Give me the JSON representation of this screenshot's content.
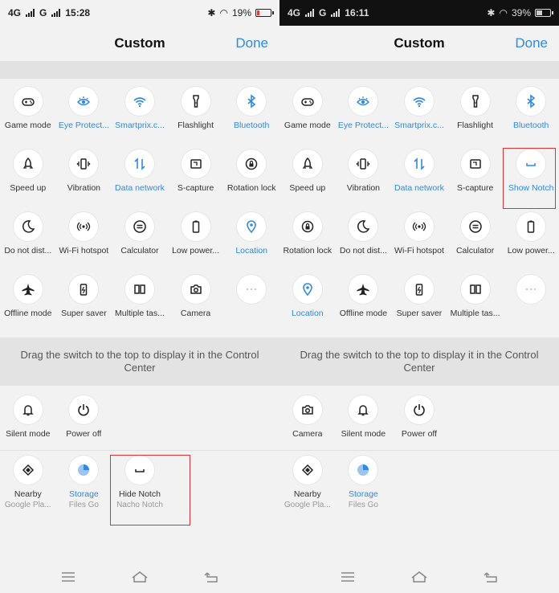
{
  "status_left": {
    "time": "15:28",
    "net1": "4G",
    "net2": "G",
    "battery": "19%",
    "battery_level": 0.19
  },
  "status_right": {
    "time": "16:11",
    "net1": "4G",
    "net2": "G",
    "battery": "39%",
    "battery_level": 0.39
  },
  "header": {
    "title": "Custom",
    "done": "Done"
  },
  "divider_text": "Drag the switch to the top to display it in the Control Center",
  "left_grid": [
    [
      {
        "label": "Game mode",
        "icon": "gamepad-icon",
        "active": false
      },
      {
        "label": "Eye Protect...",
        "icon": "eye-icon",
        "active": true
      },
      {
        "label": "Smartprix.c...",
        "icon": "wifi-icon",
        "active": true
      },
      {
        "label": "Flashlight",
        "icon": "flashlight-icon",
        "active": false
      },
      {
        "label": "Bluetooth",
        "icon": "bluetooth-icon",
        "active": true
      }
    ],
    [
      {
        "label": "Speed up",
        "icon": "rocket-icon",
        "active": false
      },
      {
        "label": "Vibration",
        "icon": "vibration-icon",
        "active": false
      },
      {
        "label": "Data network",
        "icon": "data-network-icon",
        "active": true
      },
      {
        "label": "S-capture",
        "icon": "screenshot-icon",
        "active": false
      },
      {
        "label": "Rotation lock",
        "icon": "rotation-lock-icon",
        "active": false
      }
    ],
    [
      {
        "label": "Do not dist...",
        "icon": "moon-icon",
        "active": false
      },
      {
        "label": "Wi-Fi hotspot",
        "icon": "hotspot-icon",
        "active": false
      },
      {
        "label": "Calculator",
        "icon": "calculator-icon",
        "active": false
      },
      {
        "label": "Low power...",
        "icon": "battery-icon",
        "active": false
      },
      {
        "label": "Location",
        "icon": "location-icon",
        "active": true
      }
    ],
    [
      {
        "label": "Offline mode",
        "icon": "airplane-icon",
        "active": false
      },
      {
        "label": "Super saver",
        "icon": "super-saver-icon",
        "active": false
      },
      {
        "label": "Multiple tas...",
        "icon": "multitask-icon",
        "active": false
      },
      {
        "label": "Camera",
        "icon": "camera-icon",
        "active": false
      },
      {
        "label": "",
        "icon": "more-icon",
        "active": false
      }
    ]
  ],
  "left_available": [
    [
      {
        "label": "Silent mode",
        "icon": "bell-icon",
        "sub": ""
      },
      {
        "label": "Power off",
        "icon": "power-icon",
        "sub": ""
      }
    ],
    [
      {
        "label": "Nearby",
        "icon": "nearby-icon",
        "sub": "Google Pla..."
      },
      {
        "label": "Storage",
        "icon": "storage-icon",
        "sub": "Files Go",
        "active": true
      },
      {
        "label": "Hide Notch",
        "icon": "notch-icon",
        "sub": "Nacho Notch"
      }
    ]
  ],
  "right_grid": [
    [
      {
        "label": "Game mode",
        "icon": "gamepad-icon",
        "active": false
      },
      {
        "label": "Eye Protect...",
        "icon": "eye-icon",
        "active": true
      },
      {
        "label": "Smartprix.c...",
        "icon": "wifi-icon",
        "active": true
      },
      {
        "label": "Flashlight",
        "icon": "flashlight-icon",
        "active": false
      },
      {
        "label": "Bluetooth",
        "icon": "bluetooth-icon",
        "active": true
      }
    ],
    [
      {
        "label": "Speed up",
        "icon": "rocket-icon",
        "active": false
      },
      {
        "label": "Vibration",
        "icon": "vibration-icon",
        "active": false
      },
      {
        "label": "Data network",
        "icon": "data-network-icon",
        "active": true
      },
      {
        "label": "S-capture",
        "icon": "screenshot-icon",
        "active": false
      },
      {
        "label": "Show Notch",
        "icon": "notch-icon",
        "active": true
      }
    ],
    [
      {
        "label": "Rotation lock",
        "icon": "rotation-lock-icon",
        "active": false
      },
      {
        "label": "Do not dist...",
        "icon": "moon-icon",
        "active": false
      },
      {
        "label": "Wi-Fi hotspot",
        "icon": "hotspot-icon",
        "active": false
      },
      {
        "label": "Calculator",
        "icon": "calculator-icon",
        "active": false
      },
      {
        "label": "Low power...",
        "icon": "battery-icon",
        "active": false
      }
    ],
    [
      {
        "label": "Location",
        "icon": "location-icon",
        "active": true
      },
      {
        "label": "Offline mode",
        "icon": "airplane-icon",
        "active": false
      },
      {
        "label": "Super saver",
        "icon": "super-saver-icon",
        "active": false
      },
      {
        "label": "Multiple tas...",
        "icon": "multitask-icon",
        "active": false
      },
      {
        "label": "",
        "icon": "more-icon",
        "active": false
      }
    ]
  ],
  "right_available": [
    [
      {
        "label": "Camera",
        "icon": "camera-icon",
        "sub": ""
      },
      {
        "label": "Silent mode",
        "icon": "bell-icon",
        "sub": ""
      },
      {
        "label": "Power off",
        "icon": "power-icon",
        "sub": ""
      }
    ],
    [
      {
        "label": "Nearby",
        "icon": "nearby-icon",
        "sub": "Google Pla..."
      },
      {
        "label": "Storage",
        "icon": "storage-icon",
        "sub": "Files Go",
        "active": true
      }
    ]
  ],
  "colors": {
    "accent": "#2f8ae6",
    "highlight": "#d33333"
  }
}
